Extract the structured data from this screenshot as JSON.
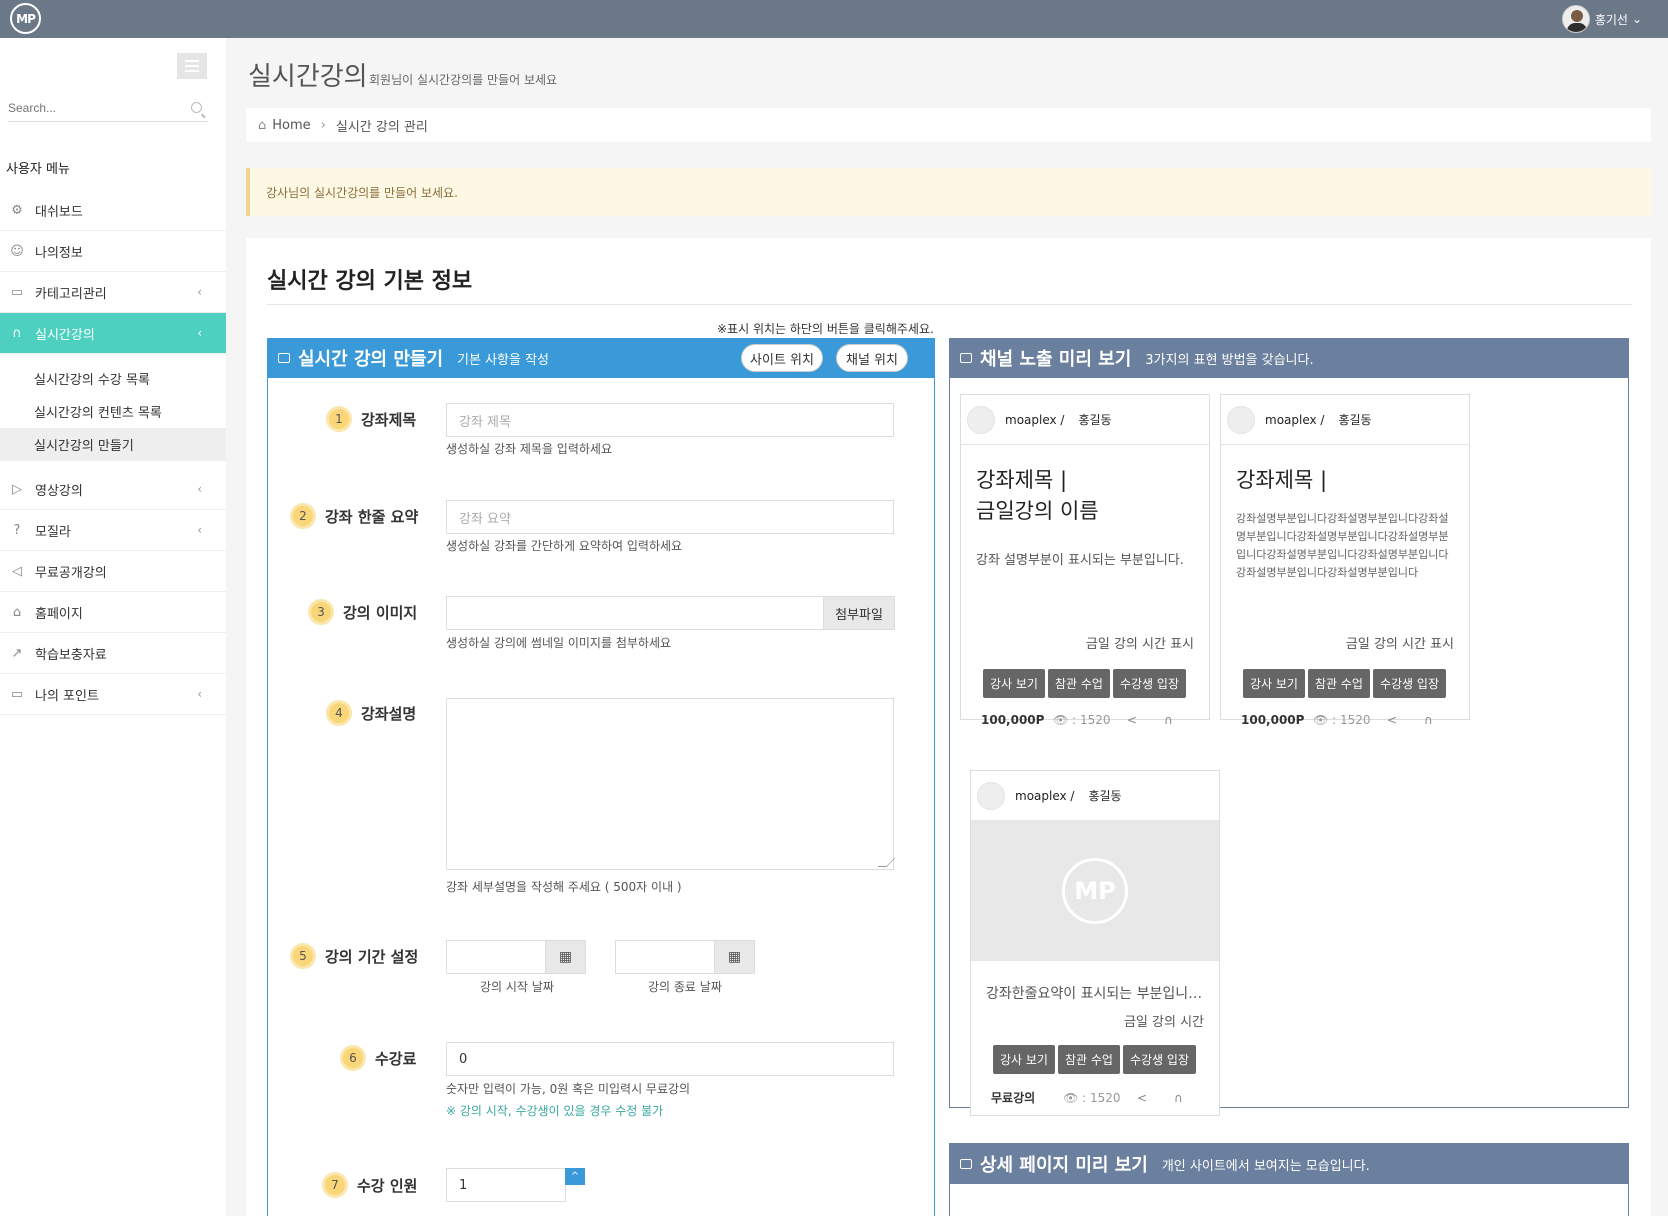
{
  "topbar": {
    "logo_text": "MP",
    "user_name": "홍기선",
    "user_caret": "⌄"
  },
  "sidebar": {
    "search_placeholder": "Search...",
    "menu_title": "사용자 메뉴",
    "items": [
      {
        "label": "대쉬보드",
        "icon": "gear-icon"
      },
      {
        "label": "나의정보",
        "icon": "user-icon"
      },
      {
        "label": "카테고리관리",
        "icon": "folder-icon",
        "has_chevron": true
      },
      {
        "label": "실시간강의",
        "icon": "headset-icon",
        "has_chevron": true,
        "active": true
      },
      {
        "label": "영상강의",
        "icon": "video-icon",
        "has_chevron": true
      },
      {
        "label": "모질라",
        "icon": "question-icon",
        "has_chevron": true
      },
      {
        "label": "무료공개강의",
        "icon": "megaphone-icon"
      },
      {
        "label": "홈페이지",
        "icon": "home-icon"
      },
      {
        "label": "학습보충자료",
        "icon": "share-icon"
      },
      {
        "label": "나의 포인트",
        "icon": "folder-icon",
        "has_chevron": true
      }
    ],
    "subitems": [
      "실시간강의 수강 목록",
      "실시간강의 컨텐츠 목록",
      "실시간강의 만들기"
    ],
    "chevron": "‹"
  },
  "header": {
    "title": "실시간강의",
    "subtitle": "회원님이 실시간강의를 만들어 보세요"
  },
  "breadcrumb": {
    "home": "Home",
    "sep": "›",
    "current": "실시간 강의 관리"
  },
  "alert": "강사님의 실시간강의를 만들어 보세요.",
  "panel": {
    "title": "실시간 강의 기본 정보",
    "notice": "※표시 위치는 하단의 버튼을 클릭해주세요."
  },
  "form": {
    "title": "실시간 강의 만들기",
    "subtitle": "기본 사항을 작성",
    "site_button": "사이트 위치",
    "channel_button": "채널 위치",
    "fields": {
      "f1": {
        "num": "1",
        "label": "강좌제목",
        "placeholder": "강좌 제목",
        "help": "생성하실 강좌 제목을 입력하세요"
      },
      "f2": {
        "num": "2",
        "label": "강좌 한줄 요약",
        "placeholder": "강좌 요약",
        "help": "생성하실 강좌를 간단하게 요약하여 입력하세요"
      },
      "f3": {
        "num": "3",
        "label": "강의 이미지",
        "button": "첨부파일",
        "help": "생성하실 강의에 썸네일 이미지를 첨부하세요"
      },
      "f4": {
        "num": "4",
        "label": "강좌설명",
        "help": "강좌 세부설명을 작성해 주세요 ( 500자 이내 )"
      },
      "f5": {
        "num": "5",
        "label": "강의 기간 설정",
        "start_help": "강의 시작 날짜",
        "end_help": "강의 종료 날짜",
        "cal_icon": "▦"
      },
      "f6": {
        "num": "6",
        "label": "수강료",
        "value": "0",
        "help": "숫자만 입력이 가능, 0원 혹은 미입력시 무료강의",
        "warn": "※ 강의 시작, 수강생이 있을 경우 수정 불가"
      },
      "f7": {
        "num": "7",
        "label": "수강 인원",
        "value": "1"
      }
    }
  },
  "preview": {
    "title": "채널 노출 미리 보기",
    "subtitle": "3가지의 표현 방법을 갖습니다.",
    "cards": [
      {
        "site": "moaplex /",
        "teacher": "홍길동",
        "title": "강좌제목 |\n금일강의 이름",
        "desc": "강좌 설명부분이 표시되는 부분입니다.",
        "time": "금일 강의 시간 표시",
        "buttons": [
          "강사 보기",
          "참관 수업",
          "수강생 입장"
        ],
        "price": "100,000P",
        "views": "👁 : 1520",
        "share": "<",
        "headset": "∩"
      },
      {
        "site": "moaplex /",
        "teacher": "홍길동",
        "title": "강좌제목 |",
        "desc": "강좌설명부분입니다강좌설명부분입니다강좌설명부분입니다강좌설명부분입니다강좌설명부분입니다강좌설명부분입니다강좌설명부분입니다강좌설명부분입니다강좌설명부분입니다",
        "time": "금일 강의 시간 표시",
        "buttons": [
          "강사 보기",
          "참관 수업",
          "수강생 입장"
        ],
        "price": "100,000P",
        "views": "👁 : 1520",
        "share": "<",
        "headset": "∩"
      },
      {
        "site": "moaplex /",
        "teacher": "홍길동",
        "thumb_logo": "MP",
        "summary": "강좌한줄요약이 표시되는 부분입니…",
        "time": "금일 강의 시간",
        "buttons": [
          "강사 보기",
          "참관 수업",
          "수강생 입장"
        ],
        "price": "무료강의",
        "views": "👁 : 1520",
        "share": "<",
        "headset": "∩"
      }
    ]
  },
  "detail": {
    "title": "상세 페이지 미리 보기",
    "subtitle": "개인 사이트에서 보여지는 모습입니다."
  }
}
